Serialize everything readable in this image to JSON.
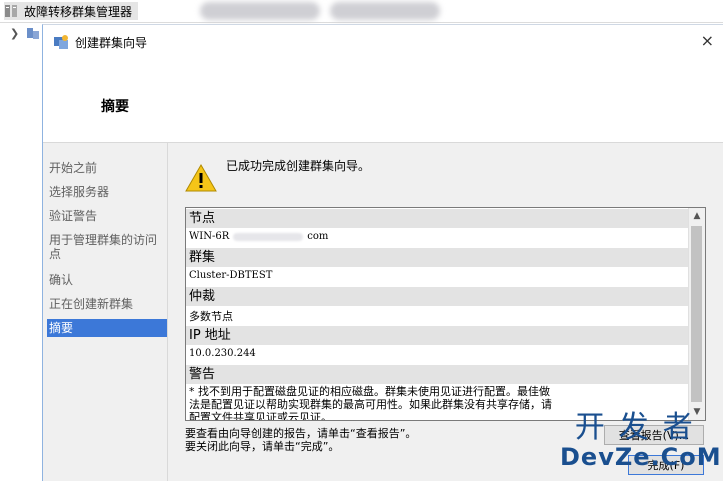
{
  "app": {
    "title": "故障转移群集管理器",
    "icon": "cluster-manager-icon"
  },
  "tree": {
    "expand_icon": "chevron-right-icon",
    "node_icon": "cluster-node-icon"
  },
  "dialog": {
    "title": "创建群集向导",
    "icon": "cluster-wizard-icon",
    "close_label": "×",
    "heading": "摘要"
  },
  "nav": {
    "items": [
      {
        "label": "开始之前"
      },
      {
        "label": "选择服务器"
      },
      {
        "label": "验证警告"
      },
      {
        "label": "用于管理群集的访问点"
      },
      {
        "label": "确认"
      },
      {
        "label": "正在创建新群集"
      },
      {
        "label": "摘要",
        "active": true
      }
    ]
  },
  "content": {
    "warning_icon": "warning-icon",
    "success_message": "已成功完成创建群集向导。",
    "report": {
      "sections": [
        {
          "header": "节点",
          "value_prefix": "WIN-6R",
          "value_suffix": "com"
        },
        {
          "header": "群集",
          "value": "Cluster-DBTEST"
        },
        {
          "header": "仲裁",
          "value": "多数节点"
        },
        {
          "header": "IP 地址",
          "value": "10.0.230.244"
        },
        {
          "header": "警告",
          "note": "* 找不到用于配置磁盘见证的相应磁盘。群集未使用见证进行配置。最佳做法是配置见证以帮助实现群集的最高可用性。如果此群集没有共享存储，请配置文件共享见证或云见证。"
        }
      ],
      "scroll_up": "▲",
      "scroll_down": "▼"
    },
    "hint_view_report": "要查看由向导创建的报告，请单击“查看报告”。",
    "hint_close": "要关闭此向导，请单击“完成”。",
    "view_report_label": "查看报告(V)...",
    "finish_label": "完成(F)"
  },
  "watermark": {
    "line1": "开发者",
    "line2": "DevZe.CoM"
  },
  "colors": {
    "selection": "#3c78d8",
    "panel_bg": "#f0f0f0",
    "section_header_bg": "#e3e3e3",
    "watermark": "#1a4f8f"
  }
}
